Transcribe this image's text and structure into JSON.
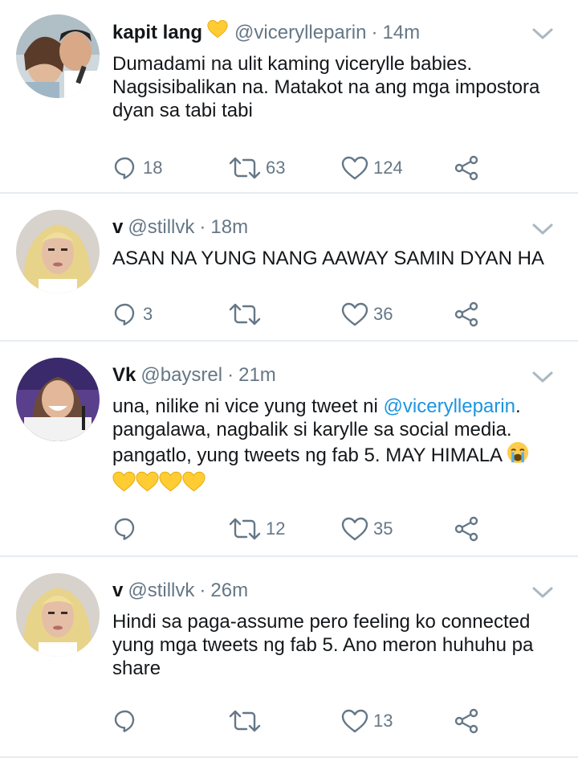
{
  "tweets": [
    {
      "name": "kapit lang",
      "name_emoji": "yellow-heart",
      "handle": "@vicerylleparin",
      "time": "14m",
      "text": "Dumadami na ulit kaming vicerylle babies. Nagsisibalikan na. Matakot na ang mga impostora dyan sa tabi tabi",
      "replies": "18",
      "retweets": "63",
      "likes": "124"
    },
    {
      "name": "v",
      "handle": "@stillvk",
      "time": "18m",
      "text": "ASAN NA YUNG NANG AAWAY SAMIN DYAN HA",
      "replies": "3",
      "retweets": "",
      "likes": "36"
    },
    {
      "name": "Vk",
      "handle": "@baysrel",
      "time": "21m",
      "text_part1": "una, nilike ni vice yung tweet ni ",
      "mention": "@vicerylleparin",
      "text_part2": ". pangalawa, nagbalik si karylle sa social media. pangatlo, yung tweets ng fab 5. MAY HIMALA ",
      "text_emojis": [
        "crying-face",
        "yellow-heart",
        "yellow-heart",
        "yellow-heart",
        "yellow-heart"
      ],
      "replies": "",
      "retweets": "12",
      "likes": "35"
    },
    {
      "name": "v",
      "handle": "@stillvk",
      "time": "26m",
      "text": "Hindi sa paga-assume pero feeling ko connected yung mga tweets ng fab 5. Ano meron huhuhu pa share",
      "replies": "",
      "retweets": "",
      "likes": "13"
    }
  ],
  "separator": "·",
  "colors": {
    "text": "#14171a",
    "secondary": "#657786",
    "link": "#1b95e0",
    "divider": "#e6ecf0"
  }
}
